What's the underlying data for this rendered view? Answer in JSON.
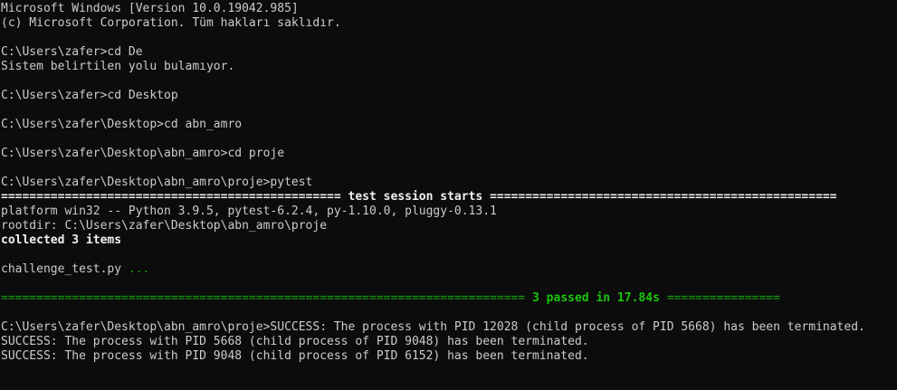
{
  "window": {
    "banner_line1": "Microsoft Windows [Version 10.0.19042.985]",
    "banner_line2": "(c) Microsoft Corporation. Tüm hakları saklıdır."
  },
  "session": {
    "prompt1": "C:\\Users\\zafer>cd De",
    "error1": "Sistem belirtilen yolu bulamıyor.",
    "prompt2": "C:\\Users\\zafer>cd Desktop",
    "prompt3": "C:\\Users\\zafer\\Desktop>cd abn_amro",
    "prompt4": "C:\\Users\\zafer\\Desktop\\abn_amro>cd proje",
    "prompt5": "C:\\Users\\zafer\\Desktop\\abn_amro\\proje>pytest"
  },
  "pytest": {
    "header_left": "================================================",
    "header_title": " test session starts ",
    "header_right": "=================================================",
    "platform": "platform win32 -- Python 3.9.5, pytest-6.2.4, py-1.10.0, pluggy-0.13.1",
    "rootdir": "rootdir: C:\\Users\\zafer\\Desktop\\abn_amro\\proje",
    "collected": "collected 3 items",
    "test_file": "challenge_test.py ",
    "test_dots": "...",
    "summary_left": "==========================================================================",
    "summary_text": " 3 passed in 17.84s ",
    "summary_right": "================"
  },
  "termination": {
    "line1": "C:\\Users\\zafer\\Desktop\\abn_amro\\proje>SUCCESS: The process with PID 12028 (child process of PID 5668) has been terminated.",
    "line2": "SUCCESS: The process with PID 5668 (child process of PID 9048) has been terminated.",
    "line3": "SUCCESS: The process with PID 9048 (child process of PID 6152) has been terminated."
  },
  "colors": {
    "background": "#0c0c0c",
    "text": "#cccccc",
    "bold_text": "#f2f2f2",
    "green": "#13a10e",
    "green_bright": "#16c60c"
  }
}
